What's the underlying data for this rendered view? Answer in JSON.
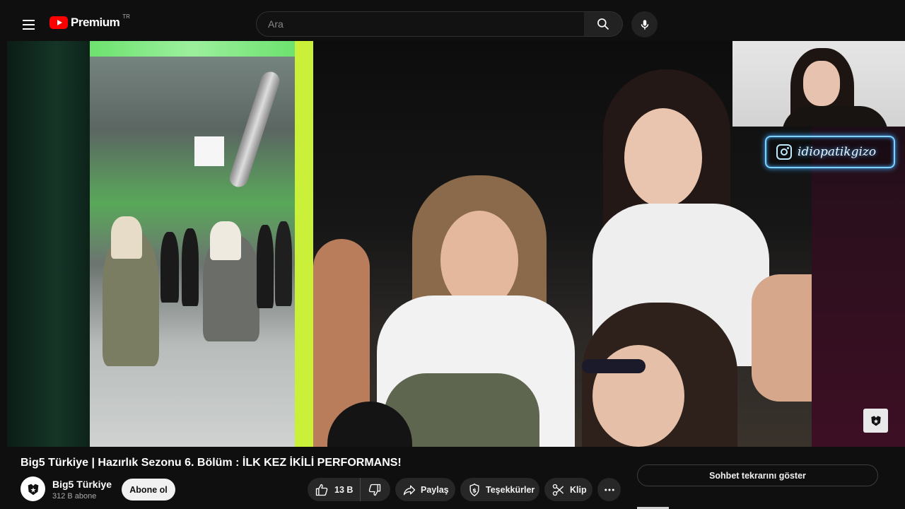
{
  "header": {
    "logo_text": "Premium",
    "region": "TR",
    "search_placeholder": "Ara"
  },
  "player": {
    "instagram_handle": "idiopatikgizo"
  },
  "video": {
    "title": "Big5 Türkiye | Hazırlık Sezonu 6. Bölüm : İLK KEZ İKİLİ PERFORMANS!",
    "channel_name": "Big5 Türkiye",
    "subscribers": "312 B abone",
    "subscribe_label": "Abone ol",
    "likes": "13 B",
    "share_label": "Paylaş",
    "thanks_label": "Teşekkürler",
    "clip_label": "Klip"
  },
  "chat": {
    "replay_label": "Sohbet tekrarını göster"
  },
  "colors": {
    "accent_red": "#ff0000",
    "neon_green": "#cbf03a",
    "neon_blue": "#3fa8ff"
  }
}
